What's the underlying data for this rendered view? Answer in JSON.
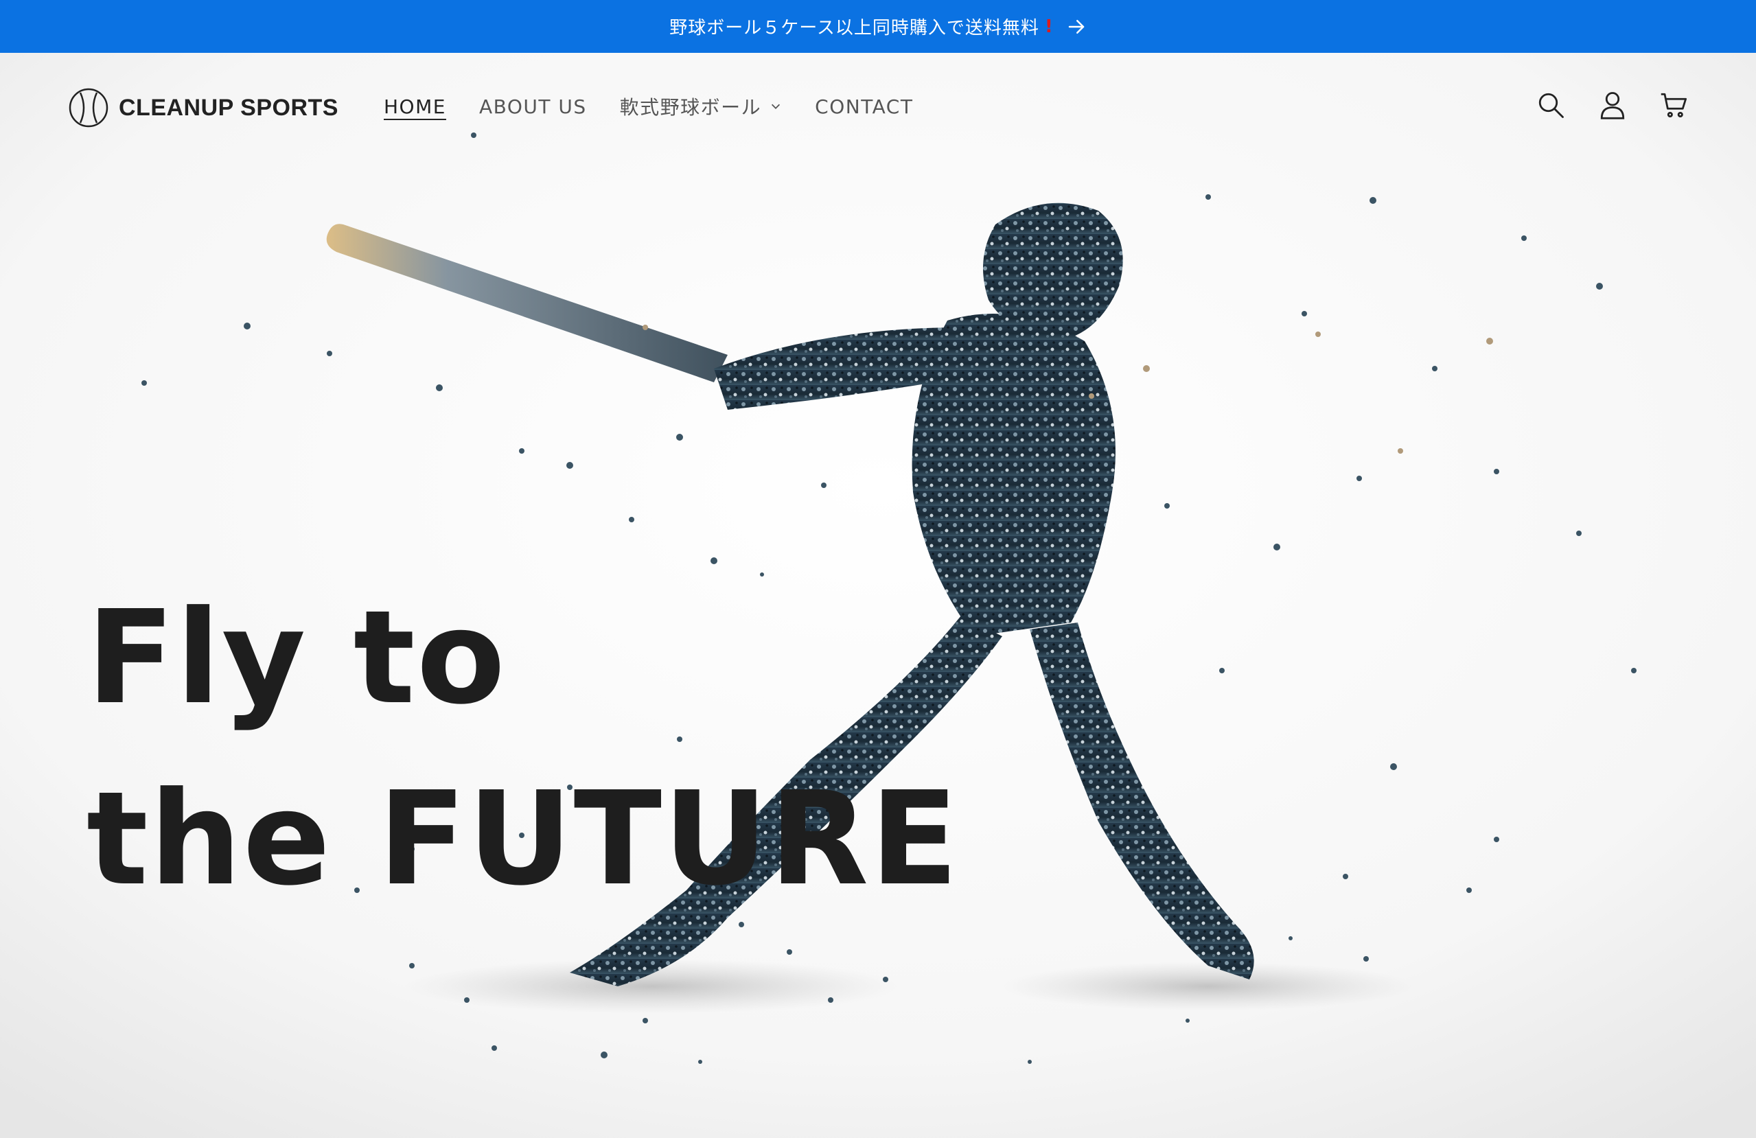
{
  "announcement": {
    "text": "野球ボール５ケース以上同時購入で送料無料",
    "emphasis": "!",
    "arrow_icon": "arrow-right-icon",
    "background": "#0b72e2"
  },
  "header": {
    "logo_text": "CLEANUP SPORTS",
    "logo_icon": "baseball-icon",
    "nav": [
      {
        "label": "HOME",
        "active": true
      },
      {
        "label": "ABOUT US"
      },
      {
        "label": "軟式野球ボール",
        "has_dropdown": true
      },
      {
        "label": "CONTACT"
      }
    ],
    "icons": [
      "search-icon",
      "account-icon",
      "cart-icon"
    ]
  },
  "hero": {
    "line1": "Fly to",
    "line2": "the FUTURE",
    "image": "baseball-batter-particle-silhouette"
  }
}
